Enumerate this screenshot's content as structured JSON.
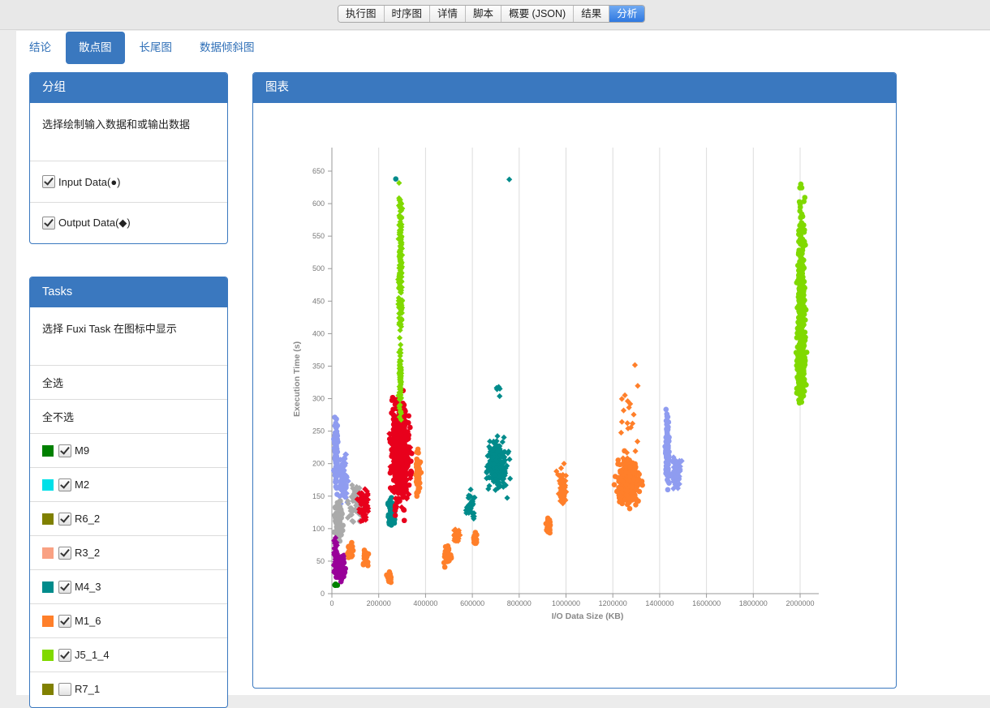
{
  "top_tabs": [
    "执行图",
    "时序图",
    "详情",
    "脚本",
    "概要 (JSON)",
    "结果",
    "分析"
  ],
  "active_top_tab": 6,
  "sub_tabs": [
    "结论",
    "散点图",
    "长尾图",
    "数据倾斜图"
  ],
  "active_sub_tab": 1,
  "group_panel": {
    "title": "分组",
    "description": "选择绘制输入数据和或输出数据",
    "options": [
      {
        "label": "Input Data(●)",
        "checked": true
      },
      {
        "label": "Output Data(◆)",
        "checked": true
      }
    ]
  },
  "tasks_panel": {
    "title": "Tasks",
    "description": "选择 Fuxi Task 在图标中显示",
    "select_all": "全选",
    "select_none": "全不选",
    "tasks": [
      {
        "name": "M9",
        "color": "#008000",
        "checked": true
      },
      {
        "name": "M2",
        "color": "#00e0e8",
        "checked": true
      },
      {
        "name": "R6_2",
        "color": "#7f8000",
        "checked": true
      },
      {
        "name": "R3_2",
        "color": "#f9a183",
        "checked": true
      },
      {
        "name": "M4_3",
        "color": "#008b8b",
        "checked": true
      },
      {
        "name": "M1_6",
        "color": "#ff7f2a",
        "checked": true
      },
      {
        "name": "J5_1_4",
        "color": "#80d900",
        "checked": true
      },
      {
        "name": "R7_1",
        "color": "#808000",
        "checked": false
      }
    ]
  },
  "chart_panel": {
    "title": "图表"
  },
  "chart_data": {
    "type": "scatter",
    "xlabel": "I/O Data Size (KB)",
    "ylabel": "Execution Time (s)",
    "xlim": [
      0,
      2080000
    ],
    "ylim": [
      0,
      690
    ],
    "x_ticks": [
      0,
      200000,
      400000,
      600000,
      800000,
      1000000,
      1200000,
      1400000,
      1600000,
      1800000,
      2000000
    ],
    "y_ticks": [
      0,
      50,
      100,
      150,
      200,
      250,
      300,
      350,
      400,
      450,
      500,
      550,
      600,
      650
    ],
    "grid": "vertical",
    "clusters": [
      {
        "color": "#8f9cf0",
        "x": [
          5000,
          30000
        ],
        "y": [
          130,
          300
        ],
        "n": 110,
        "shape": "circle"
      },
      {
        "color": "#8f9cf0",
        "x": [
          15000,
          85000
        ],
        "y": [
          120,
          230
        ],
        "n": 70,
        "shape": "diamond"
      },
      {
        "color": "#8f9cf0",
        "x": [
          1420000,
          1445000
        ],
        "y": [
          135,
          305
        ],
        "n": 110,
        "shape": "circle"
      },
      {
        "color": "#8f9cf0",
        "x": [
          1430000,
          1505000
        ],
        "y": [
          135,
          230
        ],
        "n": 60,
        "shape": "diamond"
      },
      {
        "color": "#aaaaaa",
        "x": [
          0,
          55000
        ],
        "y": [
          60,
          165
        ],
        "n": 90,
        "shape": "circle"
      },
      {
        "color": "#aaaaaa",
        "x": [
          55000,
          150000
        ],
        "y": [
          80,
          200
        ],
        "n": 55,
        "shape": "diamond"
      },
      {
        "color": "#990099",
        "x": [
          0,
          70000
        ],
        "y": [
          0,
          80
        ],
        "n": 110,
        "shape": "circle"
      },
      {
        "color": "#990099",
        "x": [
          0,
          30000
        ],
        "y": [
          0,
          110
        ],
        "n": 40,
        "shape": "diamond"
      },
      {
        "color": "#ff7f2a",
        "x": [
          60000,
          95000
        ],
        "y": [
          45,
          90
        ],
        "n": 35,
        "shape": "circle"
      },
      {
        "color": "#ff7f2a",
        "x": [
          125000,
          165000
        ],
        "y": [
          35,
          80
        ],
        "n": 35,
        "shape": "circle"
      },
      {
        "color": "#ff7f2a",
        "x": [
          225000,
          265000
        ],
        "y": [
          15,
          35
        ],
        "n": 30,
        "shape": "circle"
      },
      {
        "color": "#ff7f2a",
        "x": [
          470000,
          520000
        ],
        "y": [
          35,
          80
        ],
        "n": 60,
        "shape": "circle"
      },
      {
        "color": "#ff7f2a",
        "x": [
          515000,
          555000
        ],
        "y": [
          75,
          105
        ],
        "n": 30,
        "shape": "diamond"
      },
      {
        "color": "#ff7f2a",
        "x": [
          600000,
          625000
        ],
        "y": [
          70,
          100
        ],
        "n": 25,
        "shape": "circle"
      },
      {
        "color": "#ff7f2a",
        "x": [
          910000,
          940000
        ],
        "y": [
          85,
          125
        ],
        "n": 35,
        "shape": "circle"
      },
      {
        "color": "#ff7f2a",
        "x": [
          950000,
          1015000
        ],
        "y": [
          110,
          215
        ],
        "n": 60,
        "shape": "diamond"
      },
      {
        "color": "#ff7f2a",
        "x": [
          1190000,
          1340000
        ],
        "y": [
          115,
          230
        ],
        "n": 360,
        "shape": "circle"
      },
      {
        "color": "#ff7f2a",
        "x": [
          1200000,
          1345000
        ],
        "y": [
          140,
          400
        ],
        "n": 20,
        "shape": "diamond"
      },
      {
        "color": "#ff7f2a",
        "x": [
          350000,
          385000
        ],
        "y": [
          130,
          240
        ],
        "n": 70,
        "shape": "circle"
      },
      {
        "color": "#008b8b",
        "x": [
          230000,
          280000
        ],
        "y": [
          90,
          160
        ],
        "n": 70,
        "shape": "circle"
      },
      {
        "color": "#008b8b",
        "x": [
          560000,
          625000
        ],
        "y": [
          100,
          170
        ],
        "n": 45,
        "shape": "diamond"
      },
      {
        "color": "#008b8b",
        "x": [
          640000,
          770000
        ],
        "y": [
          140,
          255
        ],
        "n": 230,
        "shape": "diamond"
      },
      {
        "color": "#008b8b",
        "x": [
          640000,
          775000
        ],
        "y": [
          295,
          330
        ],
        "n": 5,
        "shape": "diamond"
      },
      {
        "color": "#008b8b",
        "x": [
          755000,
          760000
        ],
        "y": [
          636,
          640
        ],
        "n": 1,
        "shape": "diamond"
      },
      {
        "color": "#008b8b",
        "x": [
          270000,
          275000
        ],
        "y": [
          636,
          640
        ],
        "n": 1,
        "shape": "circle"
      },
      {
        "color": "#e8001c",
        "x": [
          100000,
          175000
        ],
        "y": [
          90,
          185
        ],
        "n": 70,
        "shape": "diamond"
      },
      {
        "color": "#e8001c",
        "x": [
          225000,
          360000
        ],
        "y": [
          85,
          360
        ],
        "n": 360,
        "shape": "circle"
      },
      {
        "color": "#e8001c",
        "x": [
          230000,
          355000
        ],
        "y": [
          95,
          300
        ],
        "n": 150,
        "shape": "diamond"
      },
      {
        "color": "#80d900",
        "x": [
          280000,
          305000
        ],
        "y": [
          330,
          690
        ],
        "n": 170,
        "shape": "diamond"
      },
      {
        "color": "#80d900",
        "x": [
          282000,
          302000
        ],
        "y": [
          240,
          420
        ],
        "n": 80,
        "shape": "diamond"
      },
      {
        "color": "#80d900",
        "x": [
          1980000,
          2030000
        ],
        "y": [
          240,
          690
        ],
        "n": 300,
        "shape": "circle"
      },
      {
        "color": "#80d900",
        "x": [
          1975000,
          2035000
        ],
        "y": [
          270,
          420
        ],
        "n": 220,
        "shape": "circle"
      },
      {
        "color": "#008000",
        "x": [
          5000,
          30000
        ],
        "y": [
          5,
          20
        ],
        "n": 6,
        "shape": "circle"
      }
    ]
  }
}
